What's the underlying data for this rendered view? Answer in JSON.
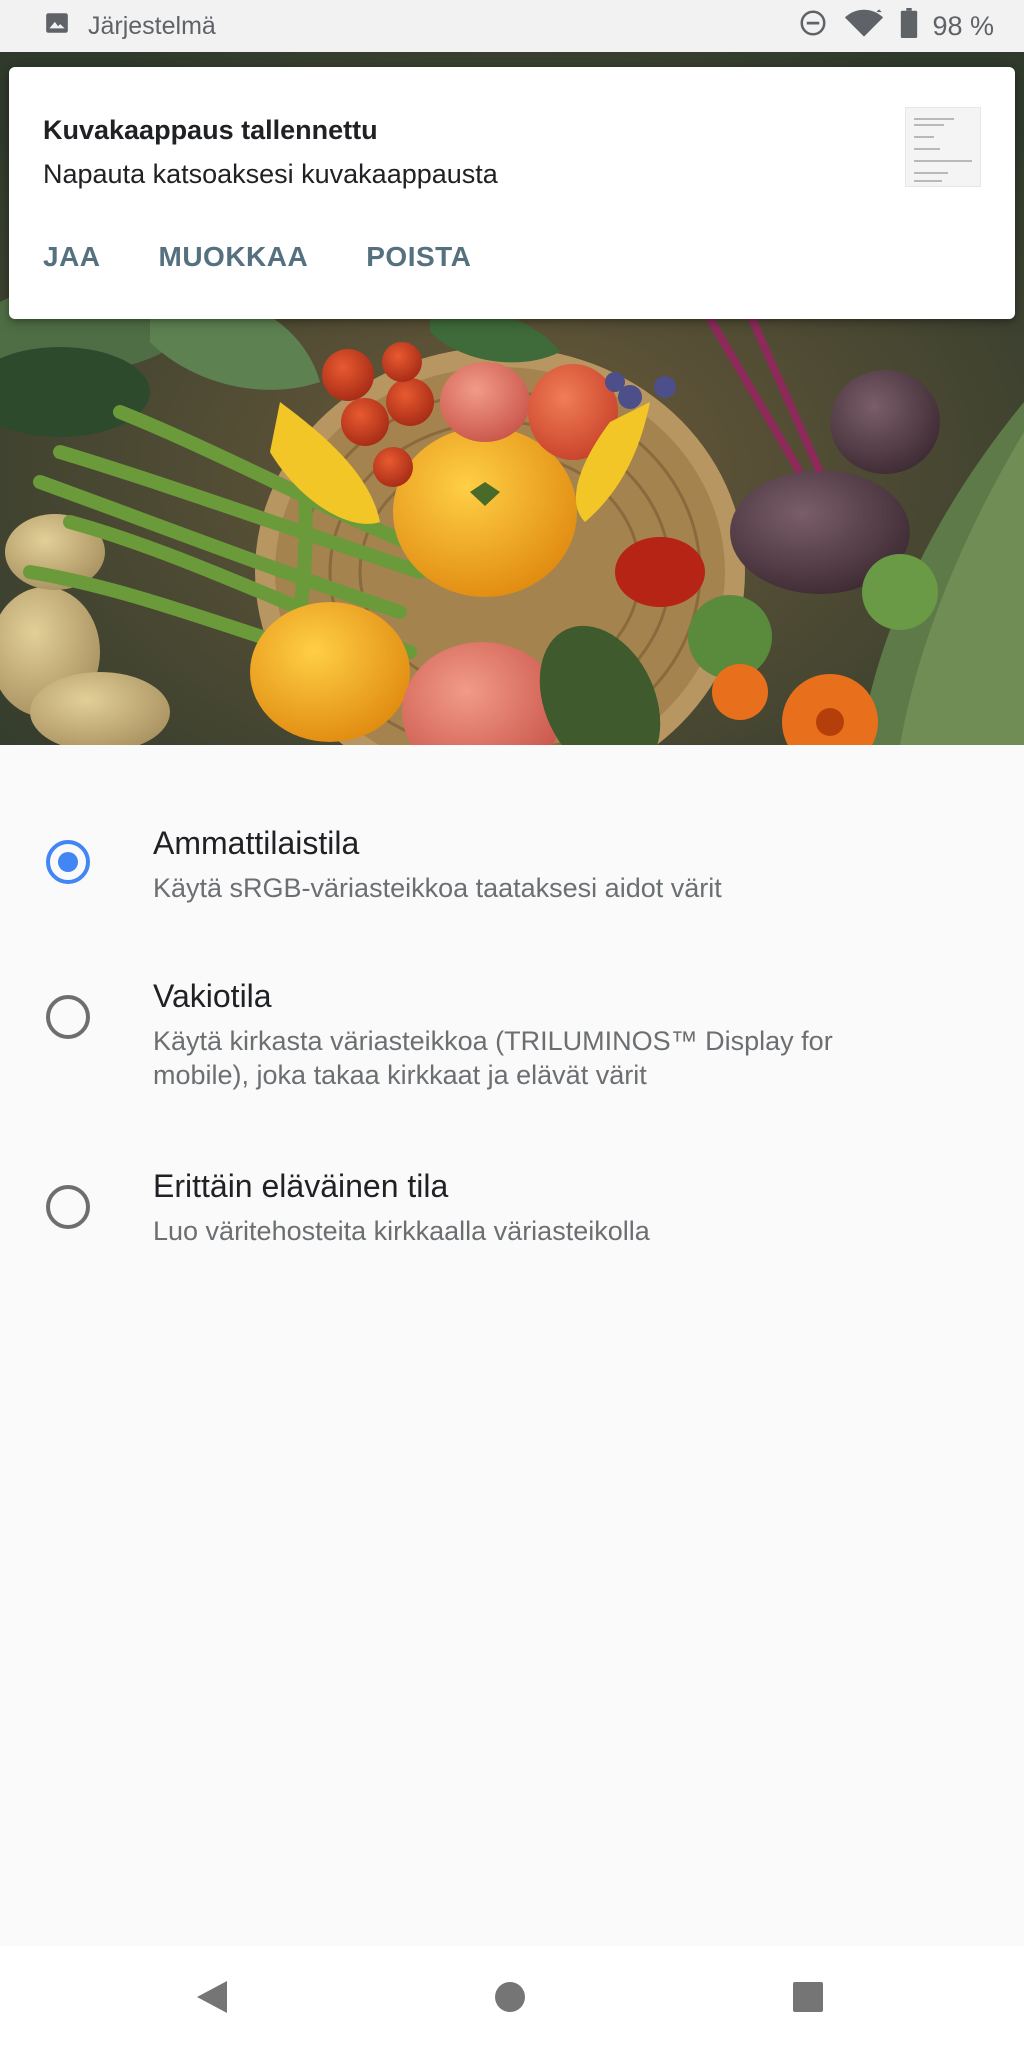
{
  "status_bar": {
    "notification_source": "Järjestelmä",
    "battery_percent": "98 %",
    "icons": [
      "image-icon",
      "do-not-disturb-icon",
      "wifi-icon",
      "battery-icon"
    ]
  },
  "notification": {
    "title": "Kuvakaappaus tallennettu",
    "text": "Napauta katsoaksesi kuvakaappausta",
    "actions": {
      "share": "JAA",
      "edit": "MUOKKAA",
      "delete": "POISTA"
    }
  },
  "hero": {
    "image": "vegetable-basket-photo"
  },
  "options": [
    {
      "title": "Ammattilaistila",
      "description": "Käytä sRGB-väriasteikkoa taataksesi aidot värit",
      "selected": true
    },
    {
      "title": "Vakiotila",
      "description": "Käytä kirkasta väriasteikkoa (TRILUMINOS™ Display for mobile), joka takaa kirkkaat ja elävät värit",
      "selected": false
    },
    {
      "title": "Erittäin eläväinen tila",
      "description": "Luo väritehosteita kirkkaalla väriasteikolla",
      "selected": false
    }
  ],
  "colors": {
    "accent": "#4285f4",
    "action_text": "#55707f",
    "background": "#fafafa"
  },
  "nav_bar": {
    "icons": [
      "back-icon",
      "home-icon",
      "recents-icon"
    ]
  }
}
